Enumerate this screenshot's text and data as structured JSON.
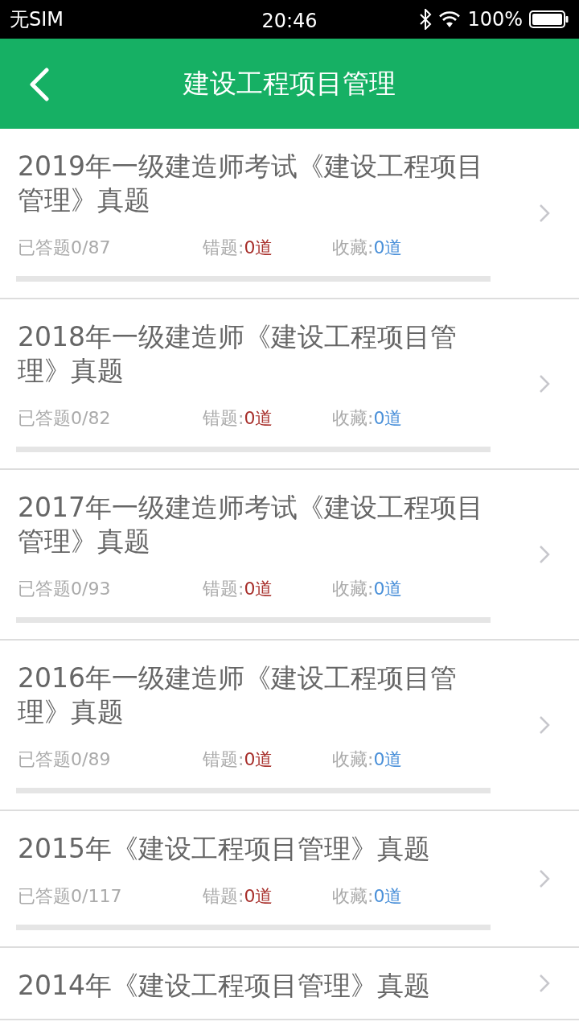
{
  "status_bar": {
    "carrier": "无SIM",
    "time": "20:46",
    "battery_text": "100%"
  },
  "header": {
    "title": "建设工程项目管理"
  },
  "papers": [
    {
      "title": "2019年一级建造师考试《建设工程项目管理》真题",
      "answered": "已答题0/87",
      "wrong_label": "错题:",
      "wrong_count": "0道",
      "fav_label": "收藏:",
      "fav_count": "0道",
      "level": 0
    },
    {
      "title": "2018年一级建造师《建设工程项目管理》真题",
      "answered": "已答题0/82",
      "wrong_label": "错题:",
      "wrong_count": "0道",
      "fav_label": "收藏:",
      "fav_count": "0道",
      "level": 0
    },
    {
      "title": "2017年一级建造师考试《建设工程项目管理》真题",
      "answered": "已答题0/93",
      "wrong_label": "错题:",
      "wrong_count": "0道",
      "fav_label": "收藏:",
      "fav_count": "0道",
      "level": 0
    },
    {
      "title": "2016年一级建造师《建设工程项目管理》真题",
      "answered": "已答题0/89",
      "wrong_label": "错题:",
      "wrong_count": "0道",
      "fav_label": "收藏:",
      "fav_count": "0道",
      "level": 0
    },
    {
      "title": "2015年《建设工程项目管理》真题",
      "answered": "已答题0/117",
      "wrong_label": "错题:",
      "wrong_count": "0道",
      "fav_label": "收藏:",
      "fav_count": "0道",
      "level": 0
    },
    {
      "title": "2014年《建设工程项目管理》真题"
    }
  ]
}
